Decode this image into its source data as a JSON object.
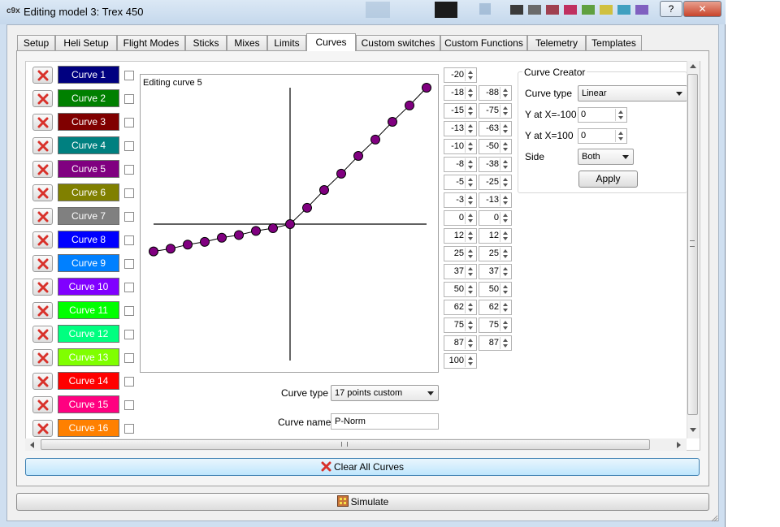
{
  "window": {
    "title": "Editing model 3: Trex 450",
    "icon_text": "c9x",
    "help_label": "?",
    "close_label": "✕"
  },
  "tabs": [
    {
      "label": "Setup",
      "active": false
    },
    {
      "label": "Heli Setup",
      "active": false
    },
    {
      "label": "Flight Modes",
      "active": false
    },
    {
      "label": "Sticks",
      "active": false
    },
    {
      "label": "Mixes",
      "active": false
    },
    {
      "label": "Limits",
      "active": false
    },
    {
      "label": "Curves",
      "active": true
    },
    {
      "label": "Custom switches",
      "active": false
    },
    {
      "label": "Custom Functions",
      "active": false
    },
    {
      "label": "Telemetry",
      "active": false
    },
    {
      "label": "Templates",
      "active": false
    }
  ],
  "curves": [
    {
      "label": "Curve 1",
      "color": "#000080",
      "text_color": "#ffffff"
    },
    {
      "label": "Curve 2",
      "color": "#008000",
      "text_color": "#ffffff"
    },
    {
      "label": "Curve 3",
      "color": "#800000",
      "text_color": "#ffffff"
    },
    {
      "label": "Curve 4",
      "color": "#008080",
      "text_color": "#ffffff"
    },
    {
      "label": "Curve 5",
      "color": "#800080",
      "text_color": "#ffffff"
    },
    {
      "label": "Curve 6",
      "color": "#808000",
      "text_color": "#ffffff"
    },
    {
      "label": "Curve 7",
      "color": "#808080",
      "text_color": "#ffffff"
    },
    {
      "label": "Curve 8",
      "color": "#0000ff",
      "text_color": "#ffffff"
    },
    {
      "label": "Curve 9",
      "color": "#0080ff",
      "text_color": "#ffffff"
    },
    {
      "label": "Curve 10",
      "color": "#8000ff",
      "text_color": "#ffffff"
    },
    {
      "label": "Curve 11",
      "color": "#00ff00",
      "text_color": "#ffffff"
    },
    {
      "label": "Curve 12",
      "color": "#00ff80",
      "text_color": "#ffffff"
    },
    {
      "label": "Curve 13",
      "color": "#80ff00",
      "text_color": "#ffffff"
    },
    {
      "label": "Curve 14",
      "color": "#ff0000",
      "text_color": "#ffffff"
    },
    {
      "label": "Curve 15",
      "color": "#ff0080",
      "text_color": "#ffffff"
    },
    {
      "label": "Curve 16",
      "color": "#ff8000",
      "text_color": "#ffffff"
    }
  ],
  "graph": {
    "title": "Editing curve 5",
    "line_color": "#000000",
    "point_color": "#800080",
    "points": [
      [
        -100,
        -20
      ],
      [
        -87.5,
        -18
      ],
      [
        -75,
        -15
      ],
      [
        -62.5,
        -13
      ],
      [
        -50,
        -10
      ],
      [
        -37.5,
        -8
      ],
      [
        -25,
        -5
      ],
      [
        -12.5,
        -3
      ],
      [
        0,
        0
      ],
      [
        12.5,
        12
      ],
      [
        25,
        25
      ],
      [
        37.5,
        37
      ],
      [
        50,
        50
      ],
      [
        62.5,
        62
      ],
      [
        75,
        75
      ],
      [
        87.5,
        87
      ],
      [
        100,
        100
      ]
    ]
  },
  "y_values": [
    "-20",
    "-18",
    "-15",
    "-13",
    "-10",
    "-8",
    "-5",
    "-3",
    "0",
    "12",
    "25",
    "37",
    "50",
    "62",
    "75",
    "87",
    "100"
  ],
  "x_values": [
    "-88",
    "-75",
    "-63",
    "-50",
    "-38",
    "-25",
    "-13",
    "0",
    "12",
    "25",
    "37",
    "50",
    "62",
    "75",
    "87"
  ],
  "curve_type": {
    "label": "Curve type",
    "value": "17 points custom"
  },
  "curve_name": {
    "label": "Curve name",
    "value": "P-Norm"
  },
  "creator": {
    "title": "Curve Creator",
    "curve_type_label": "Curve type",
    "curve_type_value": "Linear",
    "y_min_label": "Y at X=-100",
    "y_min_value": "0",
    "y_max_label": "Y at X=100",
    "y_max_value": "0",
    "side_label": "Side",
    "side_value": "Both",
    "apply_label": "Apply"
  },
  "clear_all_label": "Clear All Curves",
  "simulate_label": "Simulate"
}
